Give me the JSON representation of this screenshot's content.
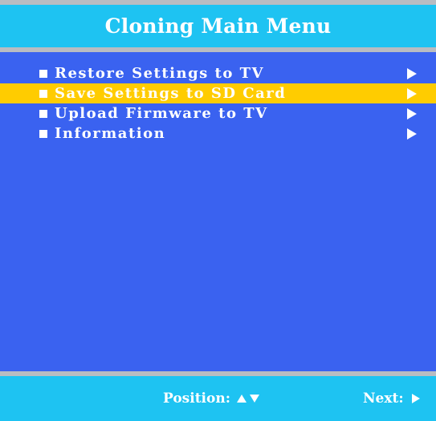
{
  "header": {
    "title": "Cloning Main Menu"
  },
  "menu": {
    "items": [
      {
        "label": "Restore Settings to TV",
        "selected": false,
        "bullet_icon": "square-bullet-icon",
        "arrow_icon": "right-arrow-icon"
      },
      {
        "label": "Save Settings to SD Card",
        "selected": true,
        "bullet_icon": "square-bullet-icon",
        "arrow_icon": "right-arrow-icon"
      },
      {
        "label": "Upload Firmware to TV",
        "selected": false,
        "bullet_icon": "square-bullet-icon",
        "arrow_icon": "right-arrow-icon"
      },
      {
        "label": "Information",
        "selected": false,
        "bullet_icon": "square-bullet-icon",
        "arrow_icon": "right-arrow-icon"
      }
    ]
  },
  "footer": {
    "position_label": "Position:",
    "position_icons": [
      "up-arrow-icon",
      "down-arrow-icon"
    ],
    "next_label": "Next:",
    "next_icon": "right-arrow-icon"
  },
  "colors": {
    "background": "#3a62f0",
    "title_bar": "#1ec3f2",
    "divider": "#b9bcc2",
    "selection": "#ffcc00",
    "text": "#ffffff"
  }
}
